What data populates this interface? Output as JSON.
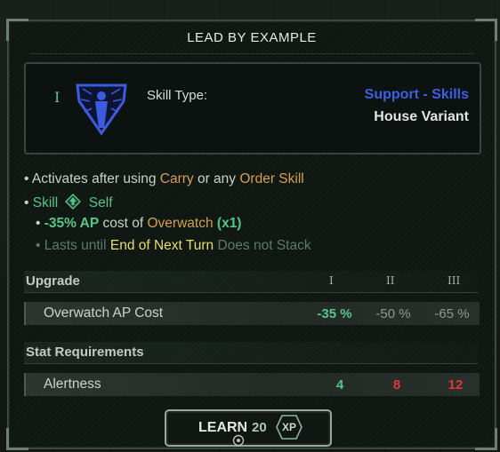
{
  "skill": {
    "title": "LEAD BY EXAMPLE",
    "rank": "I",
    "type_label": "Skill Type:",
    "category": "Support - Skills",
    "variant": "House Variant"
  },
  "description": {
    "line1": {
      "prefix": "• Activates after using",
      "carry": "Carry",
      "or_any": "or any",
      "order_skill": "Order Skill"
    },
    "line2": {
      "bullet": "•",
      "skill": "Skill",
      "self": "Self"
    },
    "line3": {
      "bullet": "•",
      "ap": "-35% AP",
      "cost_of": "cost of",
      "overwatch": "Overwatch",
      "count": "(x1)"
    },
    "line4": {
      "bullet": "•",
      "lasts": "Lasts until",
      "end": "End of Next Turn",
      "stack": "Does not Stack"
    }
  },
  "upgrade": {
    "title": "Upgrade",
    "tiers": [
      "I",
      "II",
      "III"
    ],
    "row": {
      "label": "Overwatch AP Cost",
      "values": [
        "-35 %",
        "-50 %",
        "-65 %"
      ]
    }
  },
  "requirements": {
    "title": "Stat Requirements",
    "row": {
      "label": "Alertness",
      "values": [
        "4",
        "8",
        "12"
      ]
    }
  },
  "learn_button": {
    "label": "LEARN",
    "cost": "20",
    "currency": "XP"
  },
  "colors": {
    "green": "#59c488",
    "orange": "#d4a04f",
    "blue": "#3d5ee6",
    "red": "#e0383a",
    "yellow": "#e9dd6c"
  }
}
